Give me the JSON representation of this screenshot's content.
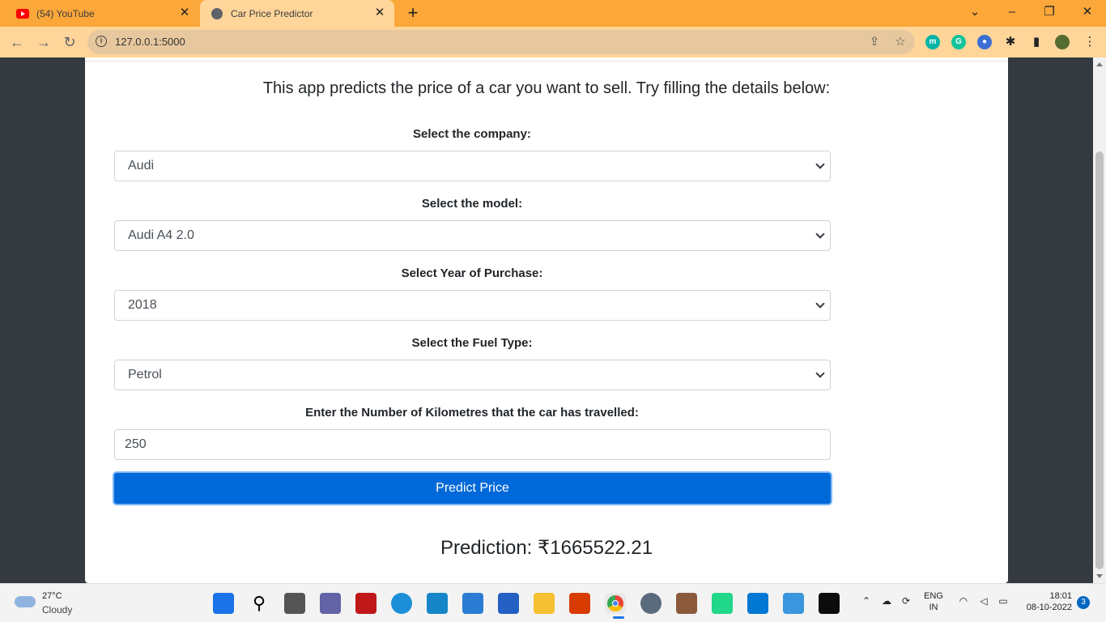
{
  "browser": {
    "tabs": [
      {
        "title": "(54) YouTube",
        "favicon": "youtube-icon"
      },
      {
        "title": "Car Price Predictor",
        "favicon": "globe-icon"
      }
    ],
    "url": "127.0.0.1:5000",
    "theme_color": "#fba73a"
  },
  "page": {
    "headline": "This app predicts the price of a car you want to sell. Try filling the details below:",
    "company_label": "Select the company:",
    "company_value": "Audi",
    "model_label": "Select the model:",
    "model_value": "Audi A4 2.0",
    "year_label": "Select Year of Purchase:",
    "year_value": "2018",
    "fuel_label": "Select the Fuel Type:",
    "fuel_value": "Petrol",
    "km_label": "Enter the Number of Kilometres that the car has travelled:",
    "km_value": "250",
    "predict_button": "Predict Price",
    "prediction": "Prediction: ₹1665522.21",
    "button_color": "#0069d9"
  },
  "taskbar": {
    "temperature": "27°C",
    "weather": "Cloudy",
    "lang_top": "ENG",
    "lang_bottom": "IN",
    "time": "18:01",
    "date": "08-10-2022",
    "notification_count": "3"
  }
}
